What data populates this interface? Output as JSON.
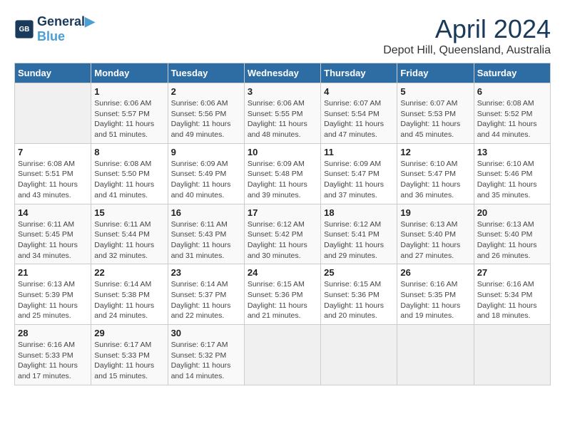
{
  "logo": {
    "line1": "General",
    "line2": "Blue"
  },
  "title": "April 2024",
  "subtitle": "Depot Hill, Queensland, Australia",
  "days_of_week": [
    "Sunday",
    "Monday",
    "Tuesday",
    "Wednesday",
    "Thursday",
    "Friday",
    "Saturday"
  ],
  "weeks": [
    [
      {
        "day": "",
        "sunrise": "",
        "sunset": "",
        "daylight": ""
      },
      {
        "day": "1",
        "sunrise": "Sunrise: 6:06 AM",
        "sunset": "Sunset: 5:57 PM",
        "daylight": "Daylight: 11 hours and 51 minutes."
      },
      {
        "day": "2",
        "sunrise": "Sunrise: 6:06 AM",
        "sunset": "Sunset: 5:56 PM",
        "daylight": "Daylight: 11 hours and 49 minutes."
      },
      {
        "day": "3",
        "sunrise": "Sunrise: 6:06 AM",
        "sunset": "Sunset: 5:55 PM",
        "daylight": "Daylight: 11 hours and 48 minutes."
      },
      {
        "day": "4",
        "sunrise": "Sunrise: 6:07 AM",
        "sunset": "Sunset: 5:54 PM",
        "daylight": "Daylight: 11 hours and 47 minutes."
      },
      {
        "day": "5",
        "sunrise": "Sunrise: 6:07 AM",
        "sunset": "Sunset: 5:53 PM",
        "daylight": "Daylight: 11 hours and 45 minutes."
      },
      {
        "day": "6",
        "sunrise": "Sunrise: 6:08 AM",
        "sunset": "Sunset: 5:52 PM",
        "daylight": "Daylight: 11 hours and 44 minutes."
      }
    ],
    [
      {
        "day": "7",
        "sunrise": "Sunrise: 6:08 AM",
        "sunset": "Sunset: 5:51 PM",
        "daylight": "Daylight: 11 hours and 43 minutes."
      },
      {
        "day": "8",
        "sunrise": "Sunrise: 6:08 AM",
        "sunset": "Sunset: 5:50 PM",
        "daylight": "Daylight: 11 hours and 41 minutes."
      },
      {
        "day": "9",
        "sunrise": "Sunrise: 6:09 AM",
        "sunset": "Sunset: 5:49 PM",
        "daylight": "Daylight: 11 hours and 40 minutes."
      },
      {
        "day": "10",
        "sunrise": "Sunrise: 6:09 AM",
        "sunset": "Sunset: 5:48 PM",
        "daylight": "Daylight: 11 hours and 39 minutes."
      },
      {
        "day": "11",
        "sunrise": "Sunrise: 6:09 AM",
        "sunset": "Sunset: 5:47 PM",
        "daylight": "Daylight: 11 hours and 37 minutes."
      },
      {
        "day": "12",
        "sunrise": "Sunrise: 6:10 AM",
        "sunset": "Sunset: 5:47 PM",
        "daylight": "Daylight: 11 hours and 36 minutes."
      },
      {
        "day": "13",
        "sunrise": "Sunrise: 6:10 AM",
        "sunset": "Sunset: 5:46 PM",
        "daylight": "Daylight: 11 hours and 35 minutes."
      }
    ],
    [
      {
        "day": "14",
        "sunrise": "Sunrise: 6:11 AM",
        "sunset": "Sunset: 5:45 PM",
        "daylight": "Daylight: 11 hours and 34 minutes."
      },
      {
        "day": "15",
        "sunrise": "Sunrise: 6:11 AM",
        "sunset": "Sunset: 5:44 PM",
        "daylight": "Daylight: 11 hours and 32 minutes."
      },
      {
        "day": "16",
        "sunrise": "Sunrise: 6:11 AM",
        "sunset": "Sunset: 5:43 PM",
        "daylight": "Daylight: 11 hours and 31 minutes."
      },
      {
        "day": "17",
        "sunrise": "Sunrise: 6:12 AM",
        "sunset": "Sunset: 5:42 PM",
        "daylight": "Daylight: 11 hours and 30 minutes."
      },
      {
        "day": "18",
        "sunrise": "Sunrise: 6:12 AM",
        "sunset": "Sunset: 5:41 PM",
        "daylight": "Daylight: 11 hours and 29 minutes."
      },
      {
        "day": "19",
        "sunrise": "Sunrise: 6:13 AM",
        "sunset": "Sunset: 5:40 PM",
        "daylight": "Daylight: 11 hours and 27 minutes."
      },
      {
        "day": "20",
        "sunrise": "Sunrise: 6:13 AM",
        "sunset": "Sunset: 5:40 PM",
        "daylight": "Daylight: 11 hours and 26 minutes."
      }
    ],
    [
      {
        "day": "21",
        "sunrise": "Sunrise: 6:13 AM",
        "sunset": "Sunset: 5:39 PM",
        "daylight": "Daylight: 11 hours and 25 minutes."
      },
      {
        "day": "22",
        "sunrise": "Sunrise: 6:14 AM",
        "sunset": "Sunset: 5:38 PM",
        "daylight": "Daylight: 11 hours and 24 minutes."
      },
      {
        "day": "23",
        "sunrise": "Sunrise: 6:14 AM",
        "sunset": "Sunset: 5:37 PM",
        "daylight": "Daylight: 11 hours and 22 minutes."
      },
      {
        "day": "24",
        "sunrise": "Sunrise: 6:15 AM",
        "sunset": "Sunset: 5:36 PM",
        "daylight": "Daylight: 11 hours and 21 minutes."
      },
      {
        "day": "25",
        "sunrise": "Sunrise: 6:15 AM",
        "sunset": "Sunset: 5:36 PM",
        "daylight": "Daylight: 11 hours and 20 minutes."
      },
      {
        "day": "26",
        "sunrise": "Sunrise: 6:16 AM",
        "sunset": "Sunset: 5:35 PM",
        "daylight": "Daylight: 11 hours and 19 minutes."
      },
      {
        "day": "27",
        "sunrise": "Sunrise: 6:16 AM",
        "sunset": "Sunset: 5:34 PM",
        "daylight": "Daylight: 11 hours and 18 minutes."
      }
    ],
    [
      {
        "day": "28",
        "sunrise": "Sunrise: 6:16 AM",
        "sunset": "Sunset: 5:33 PM",
        "daylight": "Daylight: 11 hours and 17 minutes."
      },
      {
        "day": "29",
        "sunrise": "Sunrise: 6:17 AM",
        "sunset": "Sunset: 5:33 PM",
        "daylight": "Daylight: 11 hours and 15 minutes."
      },
      {
        "day": "30",
        "sunrise": "Sunrise: 6:17 AM",
        "sunset": "Sunset: 5:32 PM",
        "daylight": "Daylight: 11 hours and 14 minutes."
      },
      {
        "day": "",
        "sunrise": "",
        "sunset": "",
        "daylight": ""
      },
      {
        "day": "",
        "sunrise": "",
        "sunset": "",
        "daylight": ""
      },
      {
        "day": "",
        "sunrise": "",
        "sunset": "",
        "daylight": ""
      },
      {
        "day": "",
        "sunrise": "",
        "sunset": "",
        "daylight": ""
      }
    ]
  ]
}
